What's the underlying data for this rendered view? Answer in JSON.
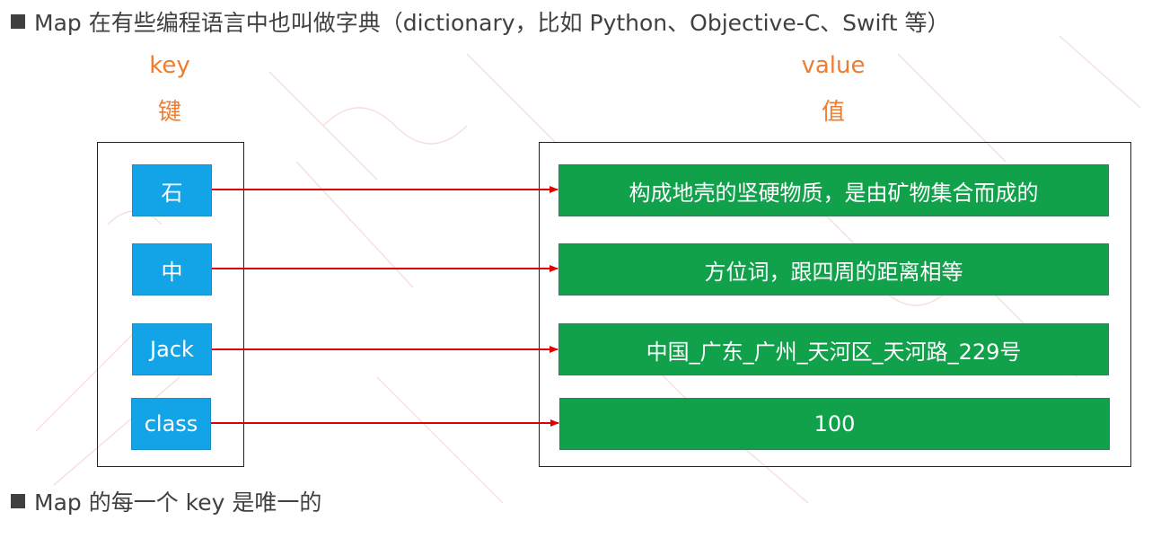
{
  "bullets": [
    "Map 在有些编程语言中也叫做字典（dictionary，比如 Python、Objective-C、Swift 等）",
    "Map 的每一个 key 是唯一的"
  ],
  "columns": {
    "key_label": "key",
    "key_label_cn": "键",
    "value_label": "value",
    "value_label_cn": "值"
  },
  "colors": {
    "label": "#ED7D31",
    "key_fill": "#12A4E6",
    "value_fill": "#12A14B",
    "arrow": "#E00000",
    "bullet_text": "#404040"
  },
  "entries": [
    {
      "key": "石",
      "value": "构成地壳的坚硬物质，是由矿物集合而成的"
    },
    {
      "key": "中",
      "value": "方位词，跟四周的距离相等"
    },
    {
      "key": "Jack",
      "value": "中国_广东_广州_天河区_天河路_229号"
    },
    {
      "key": "class",
      "value": "100"
    }
  ]
}
